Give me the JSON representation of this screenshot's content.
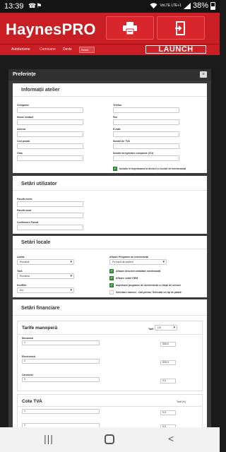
{
  "statusbar": {
    "time": "13:39",
    "notif": "☎⚑",
    "network": "VoLTE LTE+1",
    "battery": "38%"
  },
  "header": {
    "brand": "HaynesPRO",
    "print_icon": "printer-icon",
    "exit_icon": "exit-icon"
  },
  "nav": {
    "items": [
      "Autoturisme",
      "Camioane",
      "Devis"
    ],
    "lang": "Setari",
    "launch": "LAUNCH"
  },
  "modal": {
    "title": "Preferințe",
    "close": "×"
  },
  "workshop": {
    "title": "Informații atelier",
    "company": "Companie",
    "phone": "Telefon",
    "contact": "Nume contact",
    "fax": "Fax",
    "address": "Adresă",
    "email": "E-mail",
    "postal": "Cod poștal",
    "vat": "Număr de TVA",
    "locality": "Oraș",
    "reg_no": "Număr înregistrare companie (CO)",
    "include_check": "Include în imprimarea la devizei și lucrări de mentenanță"
  },
  "user": {
    "title": "Setări utilizator",
    "old_pass": "Parolă veche",
    "new_pass": "Parolă nouă",
    "confirm_pass": "Confirmare Parolă"
  },
  "local": {
    "title": "Setări locale",
    "language_label": "Limbă",
    "language_value": "Română",
    "country_label": "Țară",
    "country_value": "România",
    "unit_label": "Km/Mile",
    "unit_value": "Km",
    "maint_label": "Afișare Programe de mentenanță",
    "maint_value": "Pe bază de subiect",
    "check1": "Afișare descrieri detaliate mentenanță",
    "check2": "Afișare codul OEM",
    "check3": "Imprimare programe de mentenanță cu timpi de service",
    "check4": "Selectare camion - Cali pentru 'Selectați un tip de piatră'"
  },
  "financial": {
    "title": "Setări financiare",
    "labor_title": "Tarife manoperă",
    "rate_label": "Tarif",
    "rate_value": "LEI",
    "rows": [
      {
        "label": "Mecanică",
        "idx": "1",
        "value": "500,0"
      },
      {
        "label": "Electronică",
        "idx": "2",
        "value": "500,0"
      },
      {
        "label": "Caroserie",
        "idx": "3",
        "value": "0,0"
      }
    ],
    "vat_title": "Cote TVA",
    "vat_note": "Tarif (%)",
    "vat_rows": [
      {
        "idx": "1",
        "value": "0,0"
      },
      {
        "idx": "2",
        "value": "0,0"
      }
    ]
  },
  "navbar": {
    "recents": "|||",
    "back": "<"
  }
}
